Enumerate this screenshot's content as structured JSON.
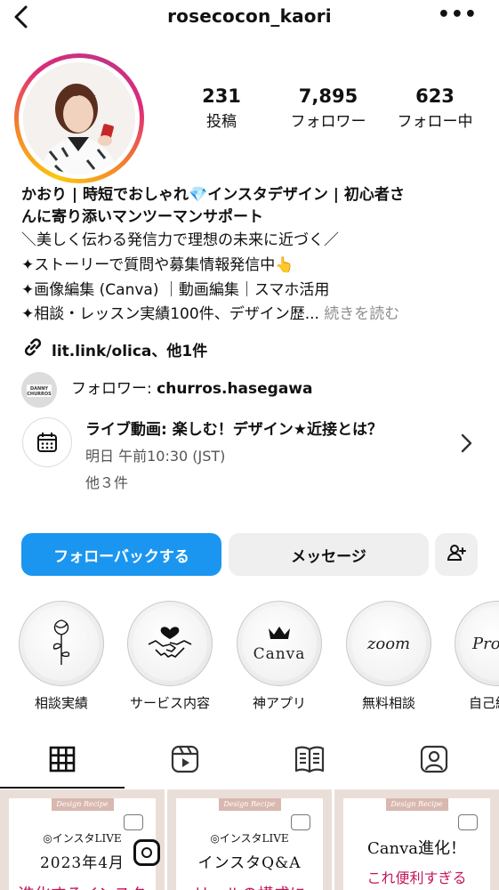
{
  "header": {
    "username": "rosecocon_kaori"
  },
  "stats": [
    {
      "value": "231",
      "label": "投稿"
    },
    {
      "value": "7,895",
      "label": "フォロワー"
    },
    {
      "value": "623",
      "label": "フォロー中"
    }
  ],
  "bio": {
    "name_line1": "かおり | 時短でおしゃれ💎インスタデザイン | 初心者さ",
    "name_line2": "んに寄り添いマンツーマンサポート",
    "lines": [
      "＼美しく伝わる発信力で理想の未来に近づく／",
      "✦ストーリーで質問や募集情報発信中👆",
      "✦画像編集 (Canva) ｜動画編集｜スマホ活用",
      "✦相談・レッスン実績100件、デザイン歴..."
    ],
    "more": " 続きを読む",
    "link": "lit.link/olica、他1件"
  },
  "followed_by": {
    "prefix": "フォロワー: ",
    "name": "churros.hasegawa",
    "avatar_text_1": "DANNY",
    "avatar_text_2": "CHURROS"
  },
  "event": {
    "title": "ライブ動画: 楽しむ！デザイン★近接とは？",
    "time": "明日 午前10:30 (JST)",
    "more": "他３件"
  },
  "buttons": {
    "follow_back": "フォローバックする",
    "message": "メッセージ"
  },
  "highlights": [
    {
      "label": "相談実績",
      "icon": "rose-icon"
    },
    {
      "label": "サービス内容",
      "icon": "handshake-icon"
    },
    {
      "label": "神アプリ",
      "icon": "crown-icon",
      "text": "Canva"
    },
    {
      "label": "無料相談",
      "text": "zoom"
    },
    {
      "label": "自己紹",
      "text": "Pro"
    }
  ],
  "tabs": [
    "grid",
    "reels",
    "guides",
    "tagged"
  ],
  "posts": [
    {
      "tag": "Design Recipe",
      "line1": "◎インスタLIVE",
      "line2": "2023年4月",
      "line3": "進化するインスタ"
    },
    {
      "tag": "Design Recipe",
      "line1": "◎インスタLIVE",
      "line2": "インスタQ&A",
      "line3": "リールの構成に"
    },
    {
      "tag": "Design Recipe",
      "line1": "Canva進化！",
      "line2": "これ便利すぎる"
    }
  ],
  "colors": {
    "accent": "#1a96f0",
    "ring_start": "#f9c80e",
    "ring_end": "#c13584",
    "post_pink": "#c2185b"
  }
}
